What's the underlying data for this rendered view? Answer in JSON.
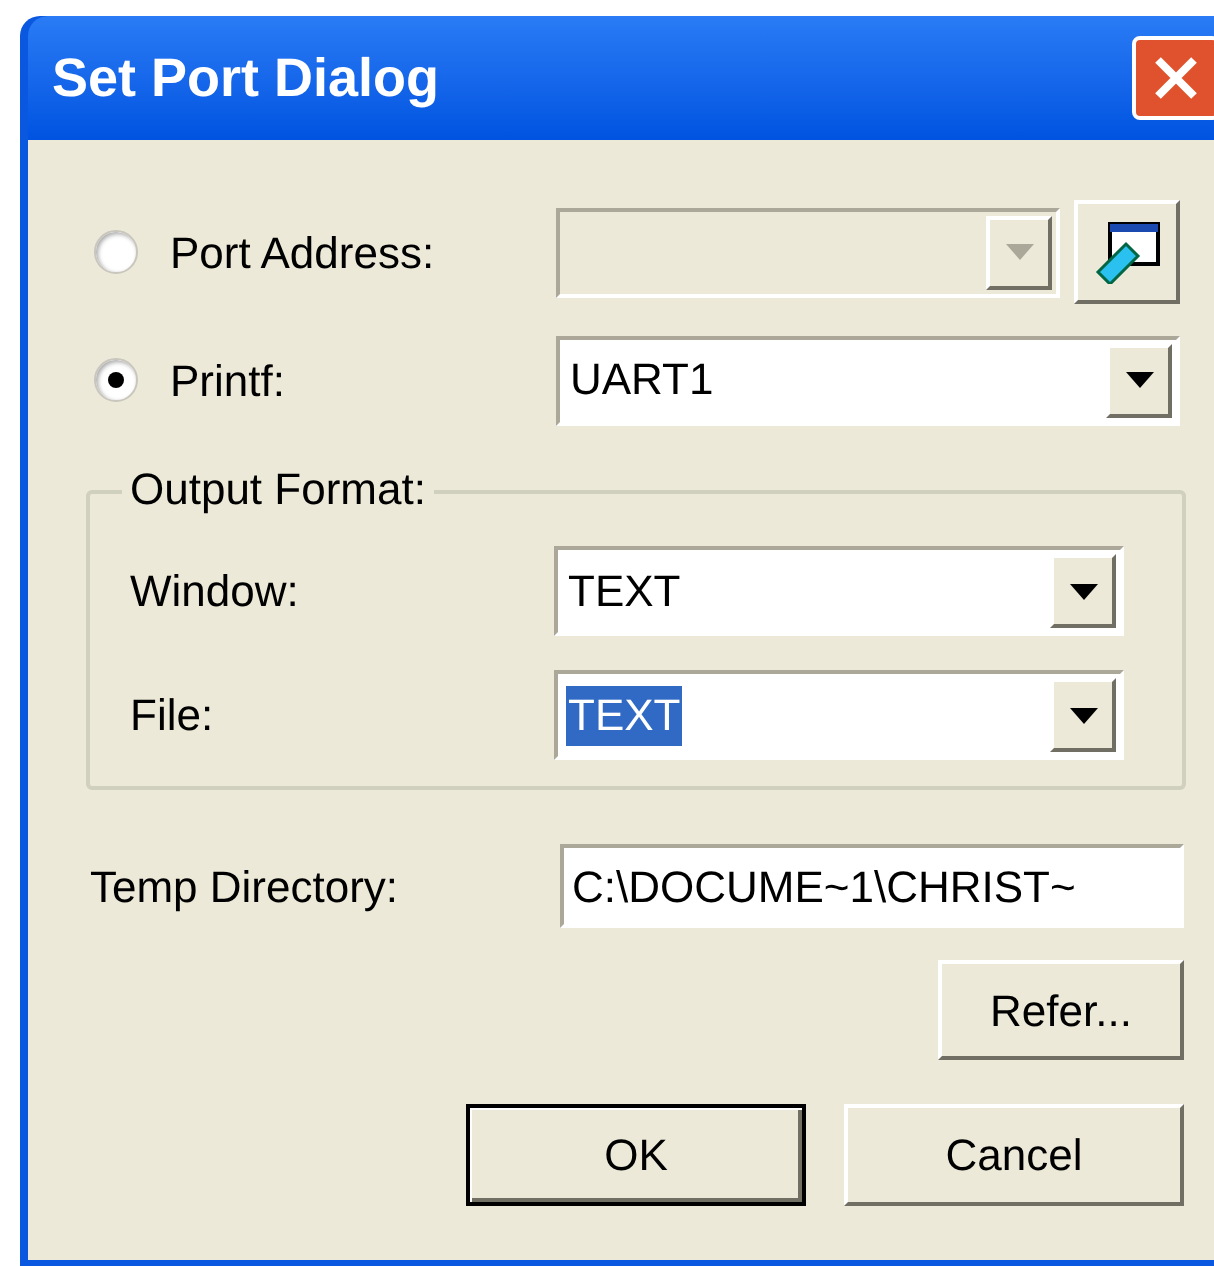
{
  "window": {
    "title": "Set Port Dialog"
  },
  "sources": [
    {
      "label": "Port Address:",
      "selected": false,
      "kind": "address",
      "combo": {
        "disabled": true
      }
    },
    {
      "label": "Printf:",
      "selected": true,
      "kind": "plain",
      "combo": {
        "value": "UART1",
        "disabled": false
      }
    }
  ],
  "output_format": {
    "legend": "Output Format:",
    "rows": [
      {
        "label": "Window:",
        "value": "TEXT",
        "text_selected": false
      },
      {
        "label": "File:",
        "value": "TEXT",
        "text_selected": true
      }
    ]
  },
  "temp_directory": {
    "label": "Temp Directory:",
    "value": "C:\\DOCUME~1\\CHRIST~"
  },
  "refer_button": "Refer...",
  "buttons": [
    {
      "label": "OK",
      "default": true
    },
    {
      "label": "Cancel",
      "default": false
    }
  ]
}
